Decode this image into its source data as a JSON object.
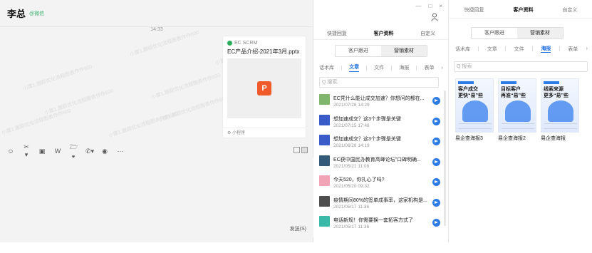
{
  "chat": {
    "contact_name": "李总",
    "contact_tag": "@微信",
    "timestamp": "14:33",
    "watermark": "小度1.跟踪优化流程图表作作600",
    "message": {
      "source": "EC SCRM",
      "file_title": "EC产品介绍-2021年3月.pptx",
      "file_icon_letter": "P",
      "footer": "小程序"
    },
    "toolbar": {
      "emoji_icon": "☺",
      "scissors_icon": "✂▾",
      "image_icon": "▣",
      "word_icon": "W",
      "folder_icon": "🗁▾",
      "phone_icon": "✆▾",
      "record_icon": "◉",
      "more_icon": "···"
    },
    "send_label": "发送(S)"
  },
  "window_controls": {
    "minimize": "—",
    "maximize": "□",
    "close": "×"
  },
  "panel": {
    "tabs": [
      {
        "label": "快捷回复"
      },
      {
        "label": "客户资料"
      },
      {
        "label": "自定义"
      }
    ],
    "segments": [
      {
        "label": "客户跟进"
      },
      {
        "label": "营销素材"
      }
    ],
    "subtabs": [
      {
        "label": "话术库"
      },
      {
        "label": "文章"
      },
      {
        "label": "文件"
      },
      {
        "label": "海报"
      },
      {
        "label": "表单"
      },
      {
        "label": "›"
      }
    ],
    "search_placeholder": "Q 搜索",
    "articles": [
      {
        "title": "EC凭什么能让成交加速？你想问的都在...",
        "date": "2021/07/28 14:29",
        "thumb_color": "#7fb56c"
      },
      {
        "title": "想加速成交？这3个步骤是关键",
        "date": "2021/07/15 17:48",
        "thumb_color": "#3a5cc8"
      },
      {
        "title": "想加速成交？这3个步骤是关键",
        "date": "2021/06/28 14:19",
        "thumb_color": "#3a5cc8"
      },
      {
        "title": "EC获中国民办教育高峰论坛”口碑明确...",
        "date": "2021/05/21 11:08",
        "thumb_color": "#345a7a"
      },
      {
        "title": "今天520，你扎心了吗?",
        "date": "2021/05/20 09:32",
        "thumb_color": "#f0a4b6"
      },
      {
        "title": "疫情期间80%的签单成事率，这家机构是...",
        "date": "2021/05/17 11:36",
        "thumb_color": "#4d4d4d"
      },
      {
        "title": "电话新规！你需要换一套拓客方式了",
        "date": "2021/05/17 11:36",
        "thumb_color": "#3ab8a8"
      }
    ]
  },
  "right_panel": {
    "tabs": [
      {
        "label": "快捷回复"
      },
      {
        "label": "客户资料"
      },
      {
        "label": "自定义"
      }
    ],
    "segments": [
      {
        "label": "客户跟进"
      },
      {
        "label": "营销素材"
      }
    ],
    "subtabs": [
      {
        "label": "话术库"
      },
      {
        "label": "文章"
      },
      {
        "label": "文件"
      },
      {
        "label": "海报"
      },
      {
        "label": "表单"
      },
      {
        "label": "›"
      }
    ],
    "search_placeholder": "Q 搜索",
    "posters": [
      {
        "line1": "客户成交",
        "line2": "更快“易”些",
        "caption": "易企查海报3"
      },
      {
        "line1": "目标客户",
        "line2": "再准“易”些",
        "caption": "易企查海报2"
      },
      {
        "line1": "线索来源",
        "line2": "更多“易”些",
        "caption": "易企查海报"
      }
    ]
  }
}
